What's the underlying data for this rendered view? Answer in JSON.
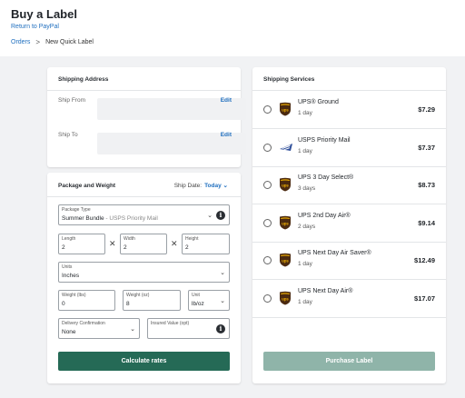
{
  "header": {
    "title": "Buy a Label",
    "return_link": "Return to PayPal",
    "breadcrumb": {
      "parent": "Orders",
      "separator": ">",
      "current": "New Quick Label"
    }
  },
  "address": {
    "title": "Shipping Address",
    "ship_from_label": "Ship From",
    "ship_to_label": "Ship To",
    "edit_label": "Edit"
  },
  "package": {
    "title": "Package and Weight",
    "ship_date_label": "Ship Date:",
    "ship_date_value": "Today",
    "package_type": {
      "label": "Package Type",
      "value": "Summer Bundle",
      "sub": " - USPS Priority Mail"
    },
    "length": {
      "label": "Length",
      "value": "2"
    },
    "width": {
      "label": "Width",
      "value": "2"
    },
    "height": {
      "label": "Height",
      "value": "2"
    },
    "dim_sep": "✕",
    "units": {
      "label": "Units",
      "value": "Inches"
    },
    "weight_lbs": {
      "label": "Weight (lbs)",
      "value": "0"
    },
    "weight_oz": {
      "label": "Weight (oz)",
      "value": "8"
    },
    "weight_unit": {
      "label": "Unit",
      "value": "lb/oz"
    },
    "delivery_confirmation": {
      "label": "Delivery Confirmation",
      "value": "None"
    },
    "insured_value": {
      "label": "Insured Value (opt)",
      "value": ""
    },
    "calculate_label": "Calculate rates"
  },
  "services": {
    "title": "Shipping Services",
    "items": [
      {
        "carrier": "UPS",
        "name": "UPS® Ground",
        "days": "1 day",
        "price": "$7.29"
      },
      {
        "carrier": "USPS",
        "name": "USPS Priority Mail",
        "days": "1 day",
        "price": "$7.37"
      },
      {
        "carrier": "UPS",
        "name": "UPS 3 Day Select®",
        "days": "3 days",
        "price": "$8.73"
      },
      {
        "carrier": "UPS",
        "name": "UPS 2nd Day Air®",
        "days": "2 days",
        "price": "$9.14"
      },
      {
        "carrier": "UPS",
        "name": "UPS Next Day Air Saver®",
        "days": "1 day",
        "price": "$12.49"
      },
      {
        "carrier": "UPS",
        "name": "UPS Next Day Air®",
        "days": "1 day",
        "price": "$17.07"
      }
    ],
    "purchase_label": "Purchase Label"
  },
  "colors": {
    "link": "#1f6fbf",
    "primary_button": "#256a56",
    "disabled_button": "#8fb4a9",
    "ups_brown": "#4b2a10",
    "ups_gold": "#f5b400",
    "usps_blue": "#2f4f9a"
  }
}
